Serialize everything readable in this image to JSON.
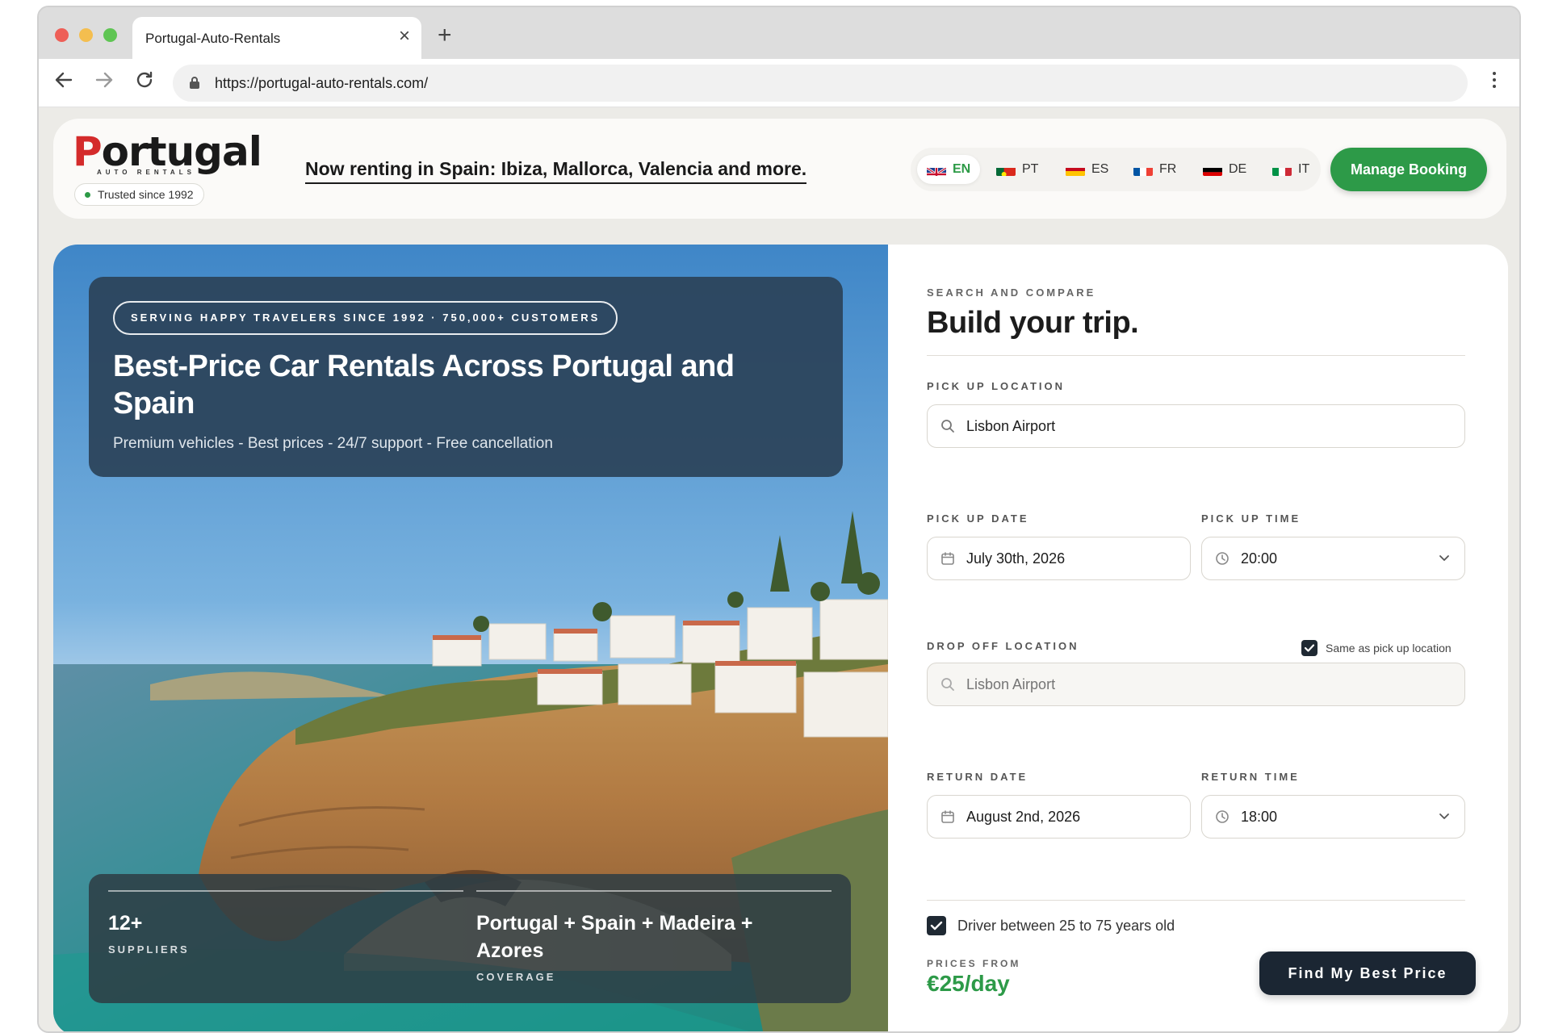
{
  "browser": {
    "tab_title": "Portugal-Auto-Rentals",
    "url": "https://portugal-auto-rentals.com/"
  },
  "header": {
    "logo_word_first": "P",
    "logo_word_rest": "ortugal",
    "logo_sub": "AUTO RENTALS",
    "trusted": "Trusted since 1992",
    "announcement": "Now renting in Spain: Ibiza, Mallorca, Valencia and more.",
    "languages": [
      {
        "code": "EN",
        "active": true
      },
      {
        "code": "PT",
        "active": false
      },
      {
        "code": "ES",
        "active": false
      },
      {
        "code": "FR",
        "active": false
      },
      {
        "code": "DE",
        "active": false
      },
      {
        "code": "IT",
        "active": false
      }
    ],
    "manage_booking": "Manage Booking"
  },
  "hero": {
    "badge": "SERVING HAPPY TRAVELERS SINCE 1992 · 750,000+ CUSTOMERS",
    "title": "Best-Price Car Rentals Across Portugal and Spain",
    "subtitle": "Premium vehicles - Best prices - 24/7 support - Free cancellation",
    "stats": [
      {
        "value": "12+",
        "label": "SUPPLIERS"
      },
      {
        "value": "Portugal + Spain + Madeira + Azores",
        "label": "COVERAGE"
      }
    ]
  },
  "form": {
    "eyebrow": "SEARCH AND COMPARE",
    "title": "Build your trip.",
    "pickup_location_label": "PICK UP LOCATION",
    "pickup_location_value": "Lisbon Airport",
    "pickup_date_label": "PICK UP DATE",
    "pickup_date_value": "July 30th, 2026",
    "pickup_time_label": "PICK UP TIME",
    "pickup_time_value": "20:00",
    "dropoff_location_label": "DROP OFF LOCATION",
    "same_location_label": "Same as pick up location",
    "same_location_checked": true,
    "dropoff_location_placeholder": "Lisbon Airport",
    "return_date_label": "RETURN DATE",
    "return_date_value": "August 2nd, 2026",
    "return_time_label": "RETURN TIME",
    "return_time_value": "18:00",
    "driver_age_label": "Driver between 25 to 75 years old",
    "driver_age_checked": true,
    "prices_from_label": "PRICES FROM",
    "prices_from_value": "€25/day",
    "submit_label": "Find My Best Price"
  },
  "colors": {
    "accent_green": "#2d9a48",
    "logo_red": "#d42b2b",
    "dark_button": "#1b2633",
    "hero_panel": "#2b4359"
  }
}
